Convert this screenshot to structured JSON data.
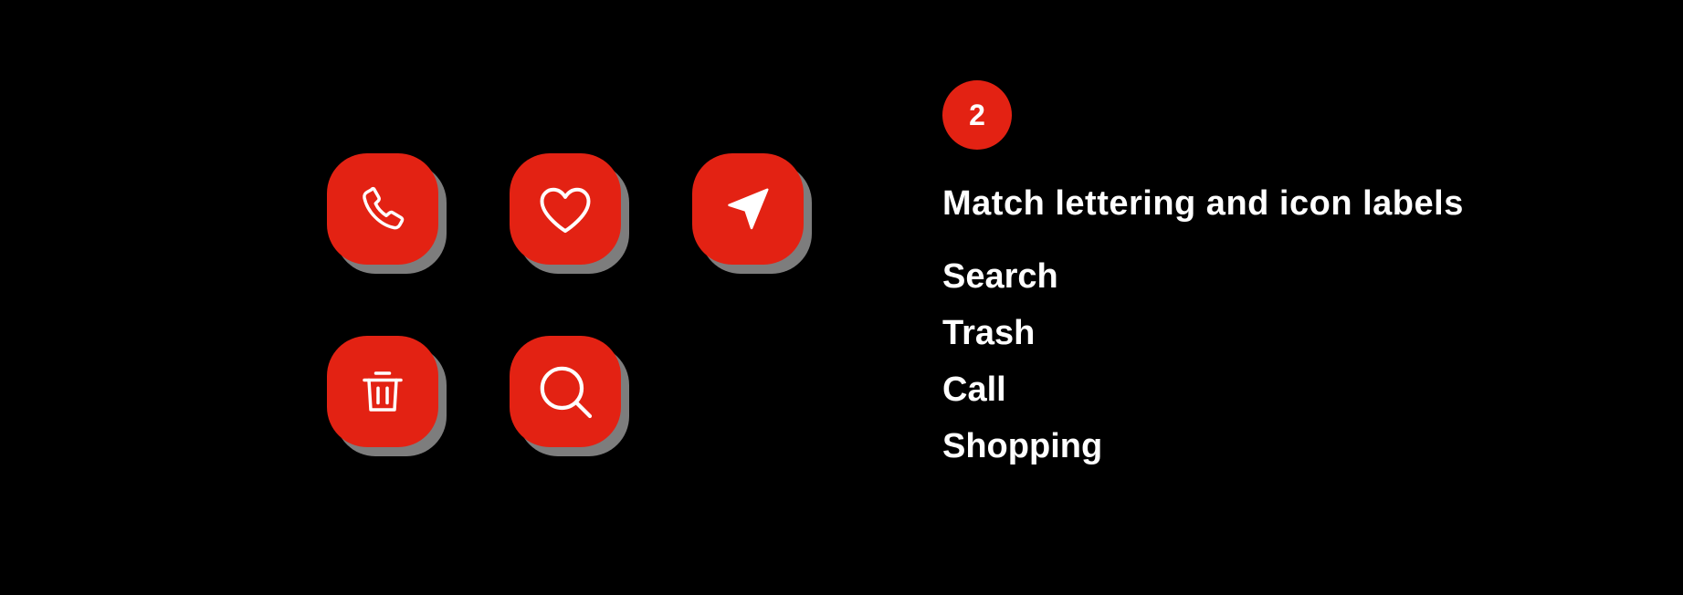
{
  "colors": {
    "background": "#000000",
    "accent": "#e32213",
    "shadow": "#7d7d7d",
    "text": "#ffffff"
  },
  "icons": [
    {
      "id": "phone",
      "icon": "phone-icon"
    },
    {
      "id": "heart",
      "icon": "heart-icon"
    },
    {
      "id": "navigation",
      "icon": "navigation-arrow-icon"
    },
    {
      "id": "trash",
      "icon": "trash-icon"
    },
    {
      "id": "search",
      "icon": "search-icon"
    }
  ],
  "panel": {
    "step_number": "2",
    "title": "Match lettering and icon labels",
    "labels": [
      "Search",
      "Trash",
      "Call",
      "Shopping"
    ]
  }
}
